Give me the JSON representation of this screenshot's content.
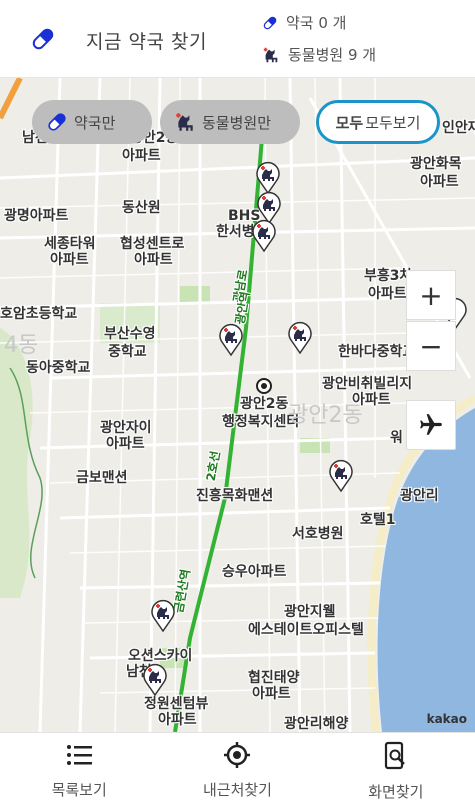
{
  "header": {
    "title": "지금 약국 찾기",
    "pharmacy_stat": "약국 0 개",
    "vet_stat": "동물병원 9 개"
  },
  "filters": {
    "pharmacy_only": "약국만",
    "vet_only": "동물병원만",
    "all_prefix": "모두",
    "all_label": "모두보기"
  },
  "map_labels": [
    "남천",
    "광안2동",
    "아파트",
    "광안화목",
    "아파트",
    "동산원",
    "BHS",
    "한서병원",
    "광명아파트",
    "세종타워",
    "아파트",
    "협성센트로",
    "아파트",
    "부흥3차",
    "아파트",
    "호암초등학교",
    "부산수영",
    "중학교",
    "동아중학교",
    "한바다중학교",
    "4동",
    "광안비취빌리지",
    "아파트",
    "광안2동",
    "행정복지센터",
    "광안2동",
    "광안자이",
    "아파트",
    "금보맨션",
    "진흥목화맨션",
    "광안리",
    "호텔1",
    "서호병원",
    "승우아파트",
    "광안지웰",
    "에스테이트오피스텔",
    "오션스카이",
    "남천",
    "협진태양",
    "아파트",
    "정원센텀뷰",
    "아파트",
    "광안리해양",
    "인안재",
    "광남로",
    "금련산역",
    "2호선",
    "광안역",
    "워"
  ],
  "map_credit": "kakao",
  "zoom": {
    "in": "+",
    "out": "−"
  },
  "nav": {
    "list": "목록보기",
    "nearby": "내근처찾기",
    "screen": "화면찾기"
  },
  "colors": {
    "accent": "#1b95c9",
    "pill_blue": "#1a2fd6",
    "marker_red": "#e53935",
    "subway_green": "#33b233",
    "sea": "#8fb7df"
  }
}
